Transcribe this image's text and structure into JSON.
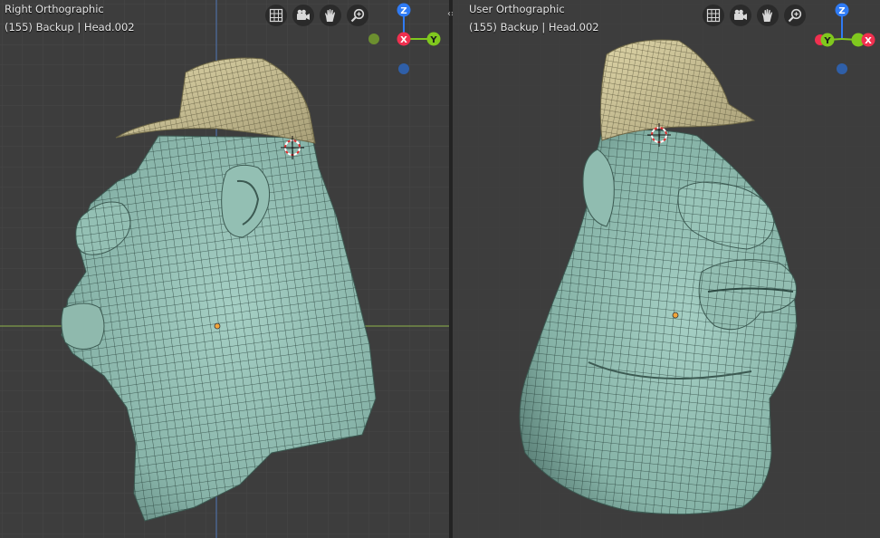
{
  "viewports": {
    "left": {
      "view_name": "Right Orthographic",
      "object_info": "(155) Backup | Head.002",
      "toolbar_icons": [
        "grid-icon",
        "camera-icon",
        "hand-icon",
        "zoom-icon"
      ],
      "gizmo_axes": [
        {
          "label": "Z",
          "color": "#2f7bf5"
        },
        {
          "label": "X",
          "color": "#f0304f"
        },
        {
          "label": "Y",
          "color": "#80c81e"
        }
      ]
    },
    "right": {
      "view_name": "User Orthographic",
      "object_info": "(155) Backup | Head.002",
      "toolbar_icons": [
        "grid-icon",
        "camera-icon",
        "hand-icon",
        "zoom-icon"
      ],
      "gizmo_axes": [
        {
          "label": "Z",
          "color": "#2f7bf5"
        },
        {
          "label": "Y",
          "color": "#80c81e"
        },
        {
          "label": "X",
          "color": "#f0304f"
        }
      ]
    }
  },
  "divider_icon": "‹›",
  "colors": {
    "viewport_bg": "#3d3d3d",
    "mesh_skin": "#8db8ad",
    "mesh_hat": "#cbc195",
    "wire": "#2f4a44",
    "axis_x_line": "#8a3b3b",
    "axis_y_line": "#6f8f3a",
    "axis_z_line": "#3c5f96"
  }
}
